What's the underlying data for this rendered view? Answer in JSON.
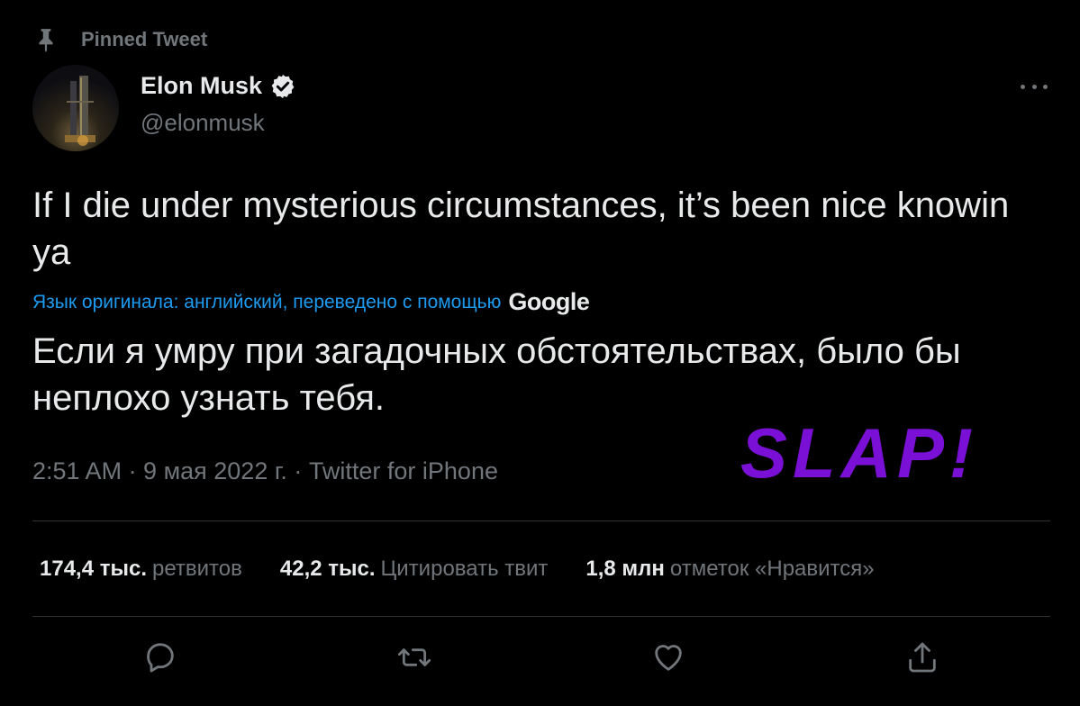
{
  "pinned": {
    "label": "Pinned Tweet",
    "icon": "pin-icon"
  },
  "author": {
    "display_name": "Elon Musk",
    "handle": "@elonmusk",
    "verified": true,
    "avatar_icon": "avatar"
  },
  "tweet": {
    "text": "If I die under mysterious circumstances, it’s been nice knowin ya",
    "translation_note": "Язык оригинала: английский, переведено с помощью",
    "translation_provider": "Google",
    "translated_text": "Если я умру при загадочных обстоятельствах, было бы неплохо узнать тебя.",
    "meta": "2:51 AM · 9 мая 2022 г. · Twitter for iPhone"
  },
  "overlay": {
    "text": "SLAP!",
    "color": "#7a0fd6"
  },
  "stats": [
    {
      "value": "174,4 тыс.",
      "label": "ретвитов"
    },
    {
      "value": "42,2 тыс.",
      "label": "Цитировать твит"
    },
    {
      "value": "1,8 млн",
      "label": "отметок «Нравится»"
    }
  ],
  "actions": [
    "reply-icon",
    "retweet-icon",
    "like-icon",
    "share-icon"
  ],
  "colors": {
    "background": "#000000",
    "text": "#e7e9ea",
    "muted": "#71767b",
    "link": "#1d9bf0",
    "divider": "#2f3336"
  }
}
